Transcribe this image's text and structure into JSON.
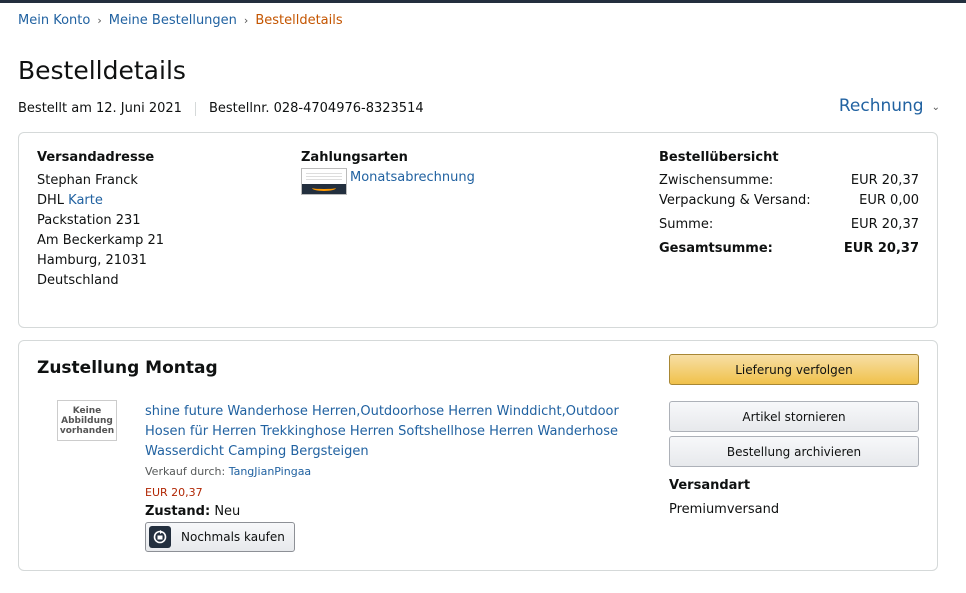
{
  "breadcrumb": {
    "items": [
      "Mein Konto",
      "Meine Bestellungen"
    ],
    "separator": "›",
    "current": "Bestelldetails"
  },
  "page": {
    "title": "Bestelldetails",
    "ordered_on": "Bestellt am 12. Juni 2021",
    "order_number": "Bestellnr. 028-4704976-8323514",
    "invoice_label": "Rechnung",
    "invoice_chevron": "⌄"
  },
  "shipping_address": {
    "title": "Versandadresse",
    "name": "Stephan Franck",
    "carrier": "DHL",
    "carrier_link": "Karte",
    "line1": "Packstation 231",
    "line2": "Am Beckerkamp 21",
    "city": "Hamburg, 21031",
    "country": "Deutschland"
  },
  "payment": {
    "title": "Zahlungsarten",
    "method": "Monatsabrechnung",
    "icon": "amazon-card-icon"
  },
  "summary": {
    "title": "Bestellübersicht",
    "rows": [
      {
        "label": "Zwischensumme:",
        "value": "EUR 20,37"
      },
      {
        "label": "Verpackung & Versand:",
        "value": "EUR 0,00"
      },
      {
        "label": "Summe:",
        "value": "EUR 20,37"
      },
      {
        "label": "Gesamtsumme:",
        "value": "EUR 20,37"
      }
    ]
  },
  "delivery": {
    "title": "Zustellung Montag",
    "no_image": [
      "Keine",
      "Abbildung",
      "vorhanden"
    ],
    "product_title": "shine future Wanderhose Herren,Outdoorhose Herren Winddicht,Outdoor Hosen für Herren Trekkinghose Herren Softshellhose Herren Wanderhose Wasserdicht Camping Bergsteigen",
    "seller_label": "Verkauf durch:",
    "seller_name": "TangJianPingaa",
    "price": "EUR 20,37",
    "condition_label": "Zustand:",
    "condition_value": "Neu",
    "buy_again": "Nochmals kaufen",
    "track_button": "Lieferung verfolgen",
    "cancel_button": "Artikel stornieren",
    "archive_button": "Bestellung archivieren",
    "shipping_type_title": "Versandart",
    "shipping_type": "Premiumversand"
  },
  "colors": {
    "link": "#2162a1",
    "breadcrumb_current": "#c45500",
    "price": "#b12704",
    "primary_button": "#f0c14b"
  }
}
